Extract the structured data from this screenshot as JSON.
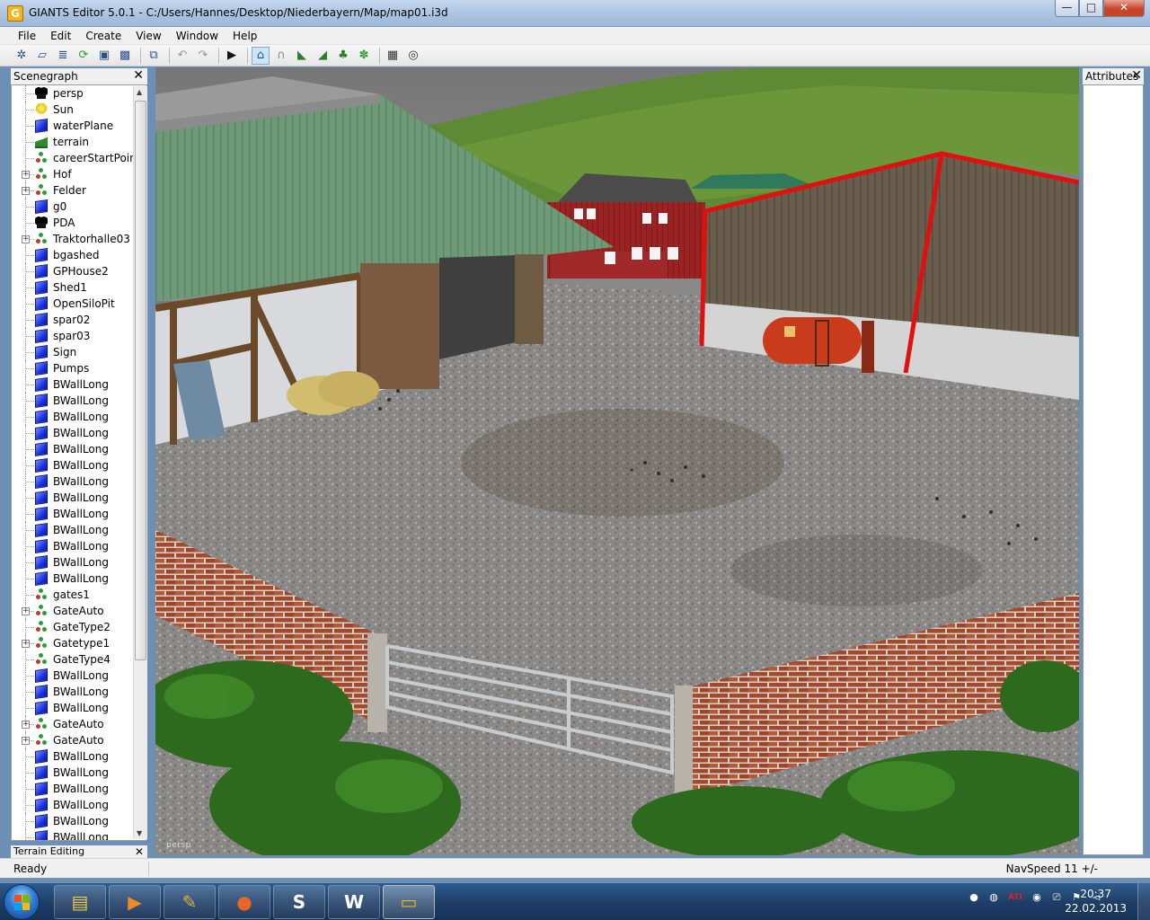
{
  "window": {
    "title": "GIANTS Editor 5.0.1 - C:/Users/Hannes/Desktop/Niederbayern/Map/map01.i3d",
    "app_icon_letter": "G",
    "min_glyph": "—",
    "max_glyph": "□",
    "close_glyph": "✕"
  },
  "menu": {
    "items": [
      "File",
      "Edit",
      "Create",
      "View",
      "Window",
      "Help"
    ]
  },
  "scenegraph": {
    "title": "Scenegraph",
    "close_glyph": "✕",
    "nodes": [
      {
        "label": "persp",
        "icon": "camera-icon",
        "expandable": false
      },
      {
        "label": "Sun",
        "icon": "light-icon",
        "expandable": false
      },
      {
        "label": "waterPlane",
        "icon": "cube-icon",
        "expandable": false
      },
      {
        "label": "terrain",
        "icon": "terrain-icon",
        "expandable": false
      },
      {
        "label": "careerStartPoint",
        "icon": "group-icon",
        "expandable": false
      },
      {
        "label": "Hof",
        "icon": "group-icon",
        "expandable": true
      },
      {
        "label": "Felder",
        "icon": "group-icon",
        "expandable": true
      },
      {
        "label": "g0",
        "icon": "cube-icon",
        "expandable": false
      },
      {
        "label": "PDA",
        "icon": "camera-icon",
        "expandable": false
      },
      {
        "label": "Traktorhalle03",
        "icon": "group-icon",
        "expandable": true
      },
      {
        "label": "bgashed",
        "icon": "cube-icon",
        "expandable": false
      },
      {
        "label": "GPHouse2",
        "icon": "cube-icon",
        "expandable": false
      },
      {
        "label": "Shed1",
        "icon": "cube-icon",
        "expandable": false
      },
      {
        "label": "OpenSiloPit",
        "icon": "cube-icon",
        "expandable": false
      },
      {
        "label": "spar02",
        "icon": "cube-icon",
        "expandable": false
      },
      {
        "label": "spar03",
        "icon": "cube-icon",
        "expandable": false
      },
      {
        "label": "Sign",
        "icon": "cube-icon",
        "expandable": false
      },
      {
        "label": "Pumps",
        "icon": "cube-icon",
        "expandable": false
      },
      {
        "label": "BWallLong",
        "icon": "cube-icon",
        "expandable": false
      },
      {
        "label": "BWallLong",
        "icon": "cube-icon",
        "expandable": false
      },
      {
        "label": "BWallLong",
        "icon": "cube-icon",
        "expandable": false
      },
      {
        "label": "BWallLong",
        "icon": "cube-icon",
        "expandable": false
      },
      {
        "label": "BWallLong",
        "icon": "cube-icon",
        "expandable": false
      },
      {
        "label": "BWallLong",
        "icon": "cube-icon",
        "expandable": false
      },
      {
        "label": "BWallLong",
        "icon": "cube-icon",
        "expandable": false
      },
      {
        "label": "BWallLong",
        "icon": "cube-icon",
        "expandable": false
      },
      {
        "label": "BWallLong",
        "icon": "cube-icon",
        "expandable": false
      },
      {
        "label": "BWallLong",
        "icon": "cube-icon",
        "expandable": false
      },
      {
        "label": "BWallLong",
        "icon": "cube-icon",
        "expandable": false
      },
      {
        "label": "BWallLong",
        "icon": "cube-icon",
        "expandable": false
      },
      {
        "label": "BWallLong",
        "icon": "cube-icon",
        "expandable": false
      },
      {
        "label": "gates1",
        "icon": "group-icon",
        "expandable": false
      },
      {
        "label": "GateAuto",
        "icon": "group-icon",
        "expandable": true
      },
      {
        "label": "GateType2",
        "icon": "group-icon",
        "expandable": false
      },
      {
        "label": "Gatetype1",
        "icon": "group-icon",
        "expandable": true
      },
      {
        "label": "GateType4",
        "icon": "group-icon",
        "expandable": false
      },
      {
        "label": "BWallLong",
        "icon": "cube-icon",
        "expandable": false
      },
      {
        "label": "BWallLong",
        "icon": "cube-icon",
        "expandable": false
      },
      {
        "label": "BWallLong",
        "icon": "cube-icon",
        "expandable": false
      },
      {
        "label": "GateAuto",
        "icon": "group-icon",
        "expandable": true
      },
      {
        "label": "GateAuto",
        "icon": "group-icon",
        "expandable": true
      },
      {
        "label": "BWallLong",
        "icon": "cube-icon",
        "expandable": false
      },
      {
        "label": "BWallLong",
        "icon": "cube-icon",
        "expandable": false
      },
      {
        "label": "BWallLong",
        "icon": "cube-icon",
        "expandable": false
      },
      {
        "label": "BWallLong",
        "icon": "cube-icon",
        "expandable": false
      },
      {
        "label": "BWallLong",
        "icon": "cube-icon",
        "expandable": false
      },
      {
        "label": "BWallLong",
        "icon": "cube-icon",
        "expandable": false
      }
    ]
  },
  "terrain_editing": {
    "title": "Terrain Editing",
    "close_glyph": "✕"
  },
  "viewport": {
    "camera_label": "persp"
  },
  "attributes": {
    "title": "Attributes",
    "close_glyph": "✕"
  },
  "status": {
    "text": "Ready",
    "navspeed": "NavSpeed 11 +/-"
  },
  "taskbar": {
    "buttons": [
      {
        "name": "explorer",
        "glyph": "▤",
        "color": "#f2c94c"
      },
      {
        "name": "media-player",
        "glyph": "▶",
        "color": "#f08a24"
      },
      {
        "name": "tools",
        "glyph": "✎",
        "color": "#e0b040"
      },
      {
        "name": "firefox",
        "glyph": "●",
        "color": "#e8662a"
      },
      {
        "name": "skype",
        "glyph": "S",
        "color": "#ffffff"
      },
      {
        "name": "word",
        "glyph": "W",
        "color": "#ffffff"
      },
      {
        "name": "giants-editor",
        "glyph": "▭",
        "color": "#f3b51b"
      }
    ],
    "tray": [
      "●",
      "◍",
      "ATI",
      "◉",
      "⎚",
      "⚑",
      "◅"
    ],
    "clock_time": "20:37",
    "clock_date": "22.02.2013"
  },
  "colors": {
    "titlebar": "#a9c2e0",
    "selection_outline": "#e01010",
    "cube_icon": "#1b2fe0",
    "taskbar": "#1f3f68"
  }
}
